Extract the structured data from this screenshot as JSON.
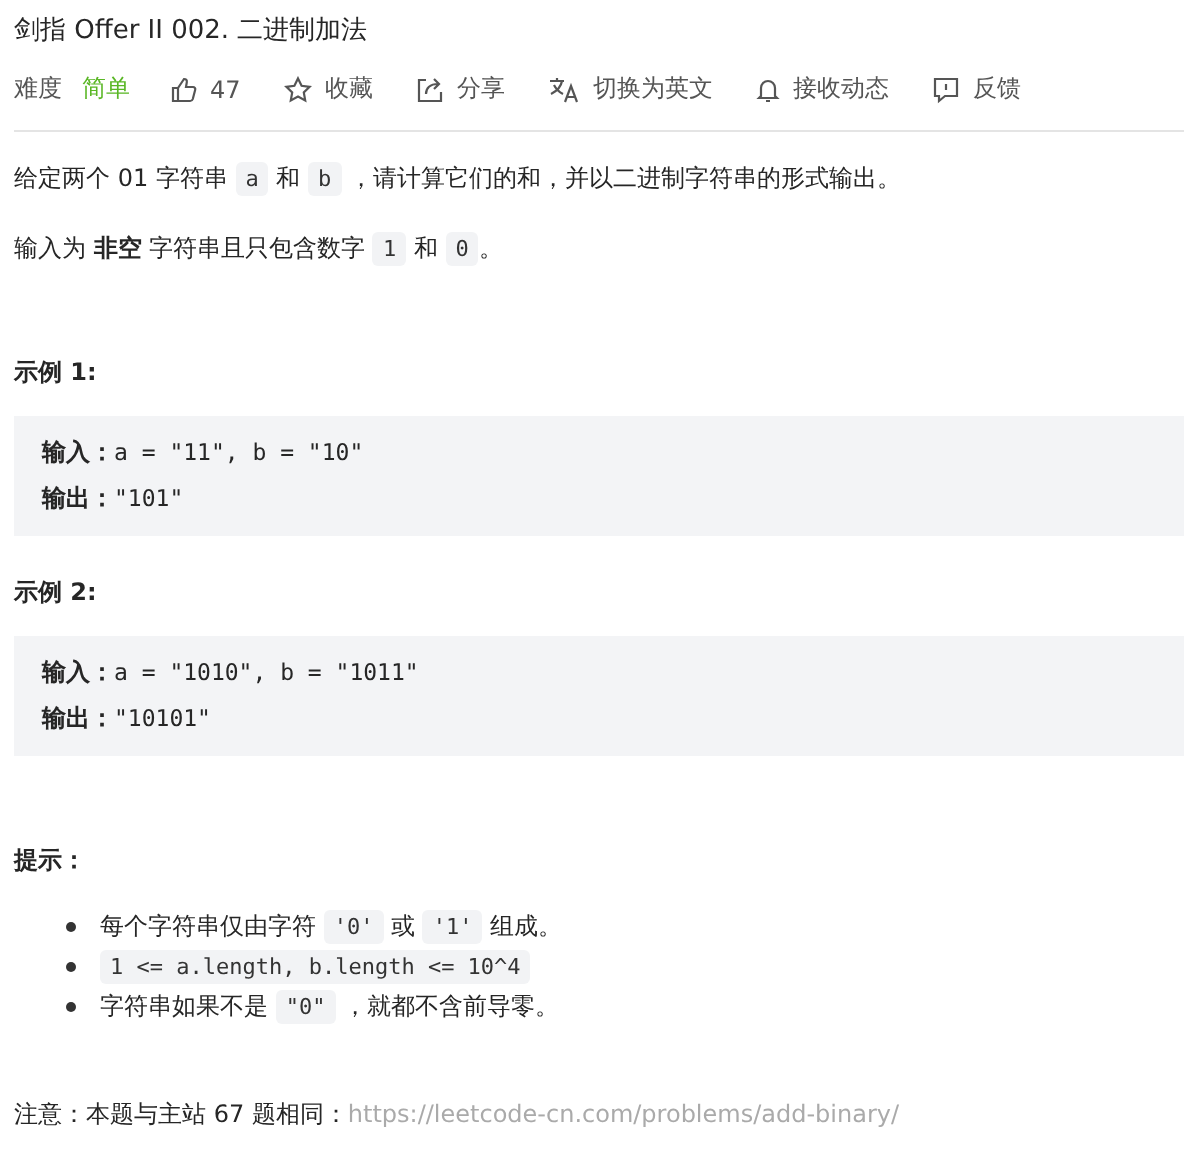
{
  "title": "剑指 Offer II 002. 二进制加法",
  "meta": {
    "difficulty_label": "难度",
    "difficulty": "简单",
    "actions": [
      {
        "kind": "like",
        "label": "47"
      },
      {
        "kind": "star",
        "label": "收藏"
      },
      {
        "kind": "share",
        "label": "分享"
      },
      {
        "kind": "translate",
        "label": "切换为英文"
      },
      {
        "kind": "bell",
        "label": "接收动态"
      },
      {
        "kind": "feedback",
        "label": "反馈"
      }
    ]
  },
  "description": [
    [
      {
        "kind": "text",
        "t": "给定两个 01 字符串 "
      },
      {
        "kind": "code",
        "t": "a"
      },
      {
        "kind": "text",
        "t": " 和 "
      },
      {
        "kind": "code",
        "t": "b"
      },
      {
        "kind": "text",
        "t": " ，请计算它们的和，并以二进制字符串的形式输出。"
      }
    ],
    [
      {
        "kind": "text",
        "t": "输入为 "
      },
      {
        "kind": "bold",
        "t": "非空"
      },
      {
        "kind": "text",
        "t": " 字符串且只包含数字 "
      },
      {
        "kind": "code",
        "t": "1"
      },
      {
        "kind": "text",
        "t": " 和 "
      },
      {
        "kind": "code",
        "t": "0"
      },
      {
        "kind": "text",
        "t": "。"
      }
    ]
  ],
  "examples": [
    {
      "heading": "示例 1:",
      "lines": [
        {
          "label": "输入：",
          "value": "a = \"11\", b = \"10\""
        },
        {
          "label": "输出：",
          "value": "\"101\""
        }
      ]
    },
    {
      "heading": "示例 2:",
      "lines": [
        {
          "label": "输入：",
          "value": "a = \"1010\", b = \"1011\""
        },
        {
          "label": "输出：",
          "value": "\"10101\""
        }
      ]
    }
  ],
  "hints_heading": "提示：",
  "hints": [
    [
      {
        "kind": "text",
        "t": "每个字符串仅由字符 "
      },
      {
        "kind": "code",
        "t": "'0'"
      },
      {
        "kind": "text",
        "t": " 或 "
      },
      {
        "kind": "code",
        "t": "'1'"
      },
      {
        "kind": "text",
        "t": " 组成。"
      }
    ],
    [
      {
        "kind": "code",
        "t": "1 <= a.length, b.length <= 10^4"
      }
    ],
    [
      {
        "kind": "text",
        "t": "字符串如果不是 "
      },
      {
        "kind": "code",
        "t": "\"0\""
      },
      {
        "kind": "text",
        "t": " ，就都不含前导零。"
      }
    ]
  ],
  "note": {
    "text": "注意：本题与主站 67 题相同：",
    "link": "https://leetcode-cn.com/problems/add-binary/"
  }
}
